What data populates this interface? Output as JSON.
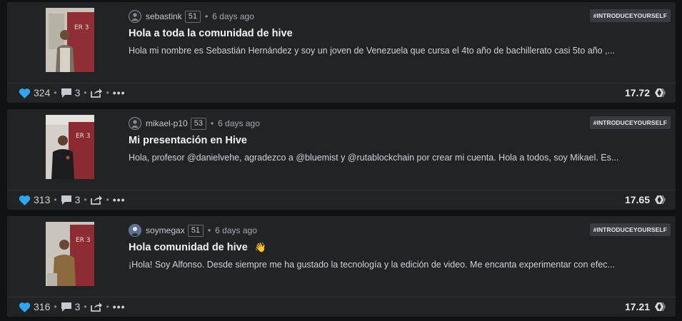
{
  "posts": [
    {
      "author": "sebastink",
      "reputation": "51",
      "time": "6 days ago",
      "tag": "#INTRODUCEYOURSELF",
      "title": "Hola a toda la comunidad de hive",
      "excerpt": "Hola mi nombre es Sebastián Hernández y soy un joven de Venezuela que cursa el 4to año de bachillerato casi 5to año ,...",
      "votes": "324",
      "comments": "3",
      "payout": "17.72",
      "avatar_icon": "user-placeholder-icon"
    },
    {
      "author": "mikael-p10",
      "reputation": "53",
      "time": "6 days ago",
      "tag": "#INTRODUCEYOURSELF",
      "title": "Mi presentación en Hive",
      "excerpt": "Hola, profesor @danielvehe, agradezco a @bluemist y @rutablockchain por crear mi cuenta. Hola a todos, soy Mikael. Es...",
      "votes": "313",
      "comments": "3",
      "payout": "17.65",
      "avatar_icon": "user-placeholder-icon"
    },
    {
      "author": "soymegax",
      "reputation": "51",
      "time": "6 days ago",
      "tag": "#INTRODUCEYOURSELF",
      "title": "Hola comunidad de hive",
      "title_emoji": "👋",
      "excerpt": "¡Hola! Soy Alfonso. Desde siempre me ha gustado la tecnología y la edición de video. Me encanta experimentar con efec...",
      "votes": "316",
      "comments": "3",
      "payout": "17.21",
      "avatar_icon": "user-photo-avatar"
    }
  ],
  "colors": {
    "background": "#111214",
    "card": "#222325",
    "heart": "#2ea7f0",
    "tag_bg": "#3a3b3e"
  }
}
